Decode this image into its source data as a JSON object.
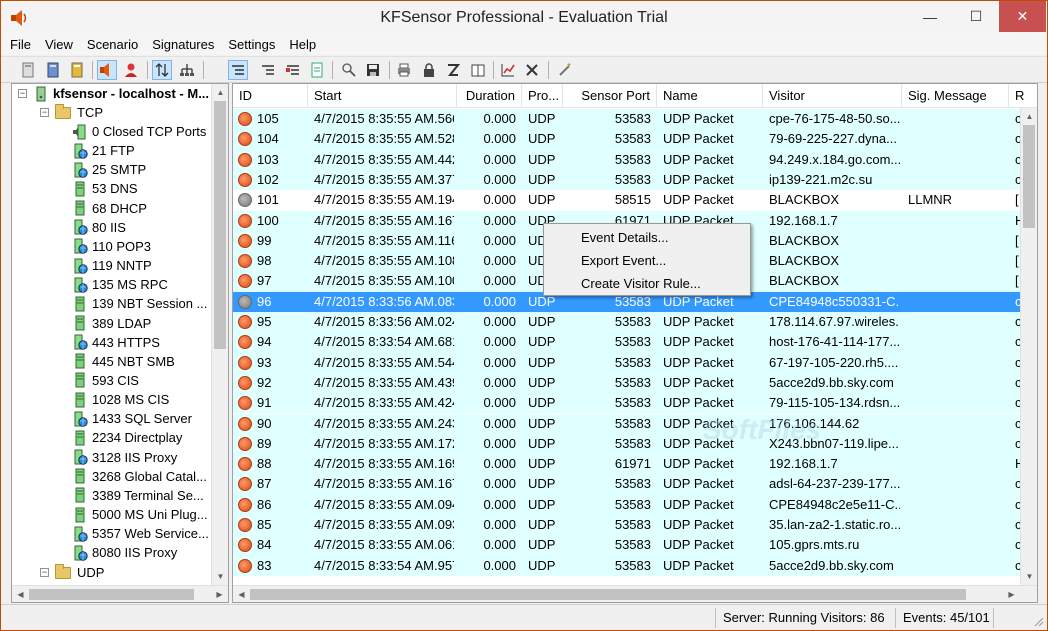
{
  "window": {
    "title": "KFSensor Professional - Evaluation Trial",
    "minimize": "—",
    "maximize": "☐",
    "close": "✕"
  },
  "menu": [
    "File",
    "View",
    "Scenario",
    "Signatures",
    "Settings",
    "Help"
  ],
  "toolbar": {
    "icons": [
      "server-icon",
      "server-blue-icon",
      "server-gold-icon",
      "speaker-icon",
      "user-icon",
      "sort-arrows-icon",
      "network-icon",
      "list-view-icon",
      "columns-icon",
      "add-column-icon",
      "export-icon",
      "magnify-icon",
      "floppy-icon",
      "printer-icon",
      "lock-icon",
      "note-icon",
      "book-icon",
      "chart-icon",
      "tools-icon",
      "wand-icon"
    ]
  },
  "tree": {
    "root": "kfsensor - localhost - M...",
    "tcp_folder": "TCP",
    "udp_folder": "UDP",
    "items": [
      {
        "label": "0  Closed TCP Ports",
        "icon": "closed-port-icon"
      },
      {
        "label": "21  FTP",
        "icon": "globe-icon"
      },
      {
        "label": "25  SMTP",
        "icon": "globe-icon"
      },
      {
        "label": "53  DNS",
        "icon": "db-icon"
      },
      {
        "label": "68  DHCP",
        "icon": "db-icon"
      },
      {
        "label": "80  IIS",
        "icon": "globe-icon"
      },
      {
        "label": "110  POP3",
        "icon": "globe-icon"
      },
      {
        "label": "119  NNTP",
        "icon": "globe-icon"
      },
      {
        "label": "135  MS RPC",
        "icon": "globe-icon"
      },
      {
        "label": "139  NBT Session ...",
        "icon": "db-icon"
      },
      {
        "label": "389  LDAP",
        "icon": "db-icon"
      },
      {
        "label": "443  HTTPS",
        "icon": "globe-icon"
      },
      {
        "label": "445  NBT SMB",
        "icon": "db-icon"
      },
      {
        "label": "593  CIS",
        "icon": "db-icon"
      },
      {
        "label": "1028  MS CIS",
        "icon": "db-icon"
      },
      {
        "label": "1433  SQL Server",
        "icon": "globe-icon"
      },
      {
        "label": "2234  Directplay",
        "icon": "db-icon"
      },
      {
        "label": "3128  IIS Proxy",
        "icon": "globe-icon"
      },
      {
        "label": "3268  Global Catal...",
        "icon": "db-icon"
      },
      {
        "label": "3389  Terminal Se...",
        "icon": "db-icon"
      },
      {
        "label": "5000  MS Uni Plug...",
        "icon": "db-icon"
      },
      {
        "label": "5357  Web Service...",
        "icon": "globe-icon"
      },
      {
        "label": "8080  IIS Proxy",
        "icon": "globe-icon"
      }
    ]
  },
  "grid": {
    "columns": [
      "ID",
      "Start",
      "Duration",
      "Pro...",
      "Sensor Port",
      "Name",
      "Visitor",
      "Sig. Message",
      "R"
    ],
    "rows": [
      {
        "id": "105",
        "start": "4/7/2015 8:35:55 AM.566",
        "duration": "0.000",
        "proto": "UDP",
        "port": "53583",
        "name": "UDP Packet",
        "visitor": "cpe-76-175-48-50.so...",
        "sig": "",
        "r": "c",
        "icon": "orange",
        "style": "cyan"
      },
      {
        "id": "104",
        "start": "4/7/2015 8:35:55 AM.528",
        "duration": "0.000",
        "proto": "UDP",
        "port": "53583",
        "name": "UDP Packet",
        "visitor": "79-69-225-227.dyna...",
        "sig": "",
        "r": "c",
        "icon": "orange",
        "style": "cyan"
      },
      {
        "id": "103",
        "start": "4/7/2015 8:35:55 AM.442",
        "duration": "0.000",
        "proto": "UDP",
        "port": "53583",
        "name": "UDP Packet",
        "visitor": "94.249.x.184.go.com....",
        "sig": "",
        "r": "c",
        "icon": "orange",
        "style": "cyan"
      },
      {
        "id": "102",
        "start": "4/7/2015 8:35:55 AM.377",
        "duration": "0.000",
        "proto": "UDP",
        "port": "53583",
        "name": "UDP Packet",
        "visitor": "ip139-221.m2c.su",
        "sig": "",
        "r": "c",
        "icon": "orange",
        "style": "cyan"
      },
      {
        "id": "101",
        "start": "4/7/2015 8:35:55 AM.194",
        "duration": "0.000",
        "proto": "UDP",
        "port": "58515",
        "name": "UDP Packet",
        "visitor": "BLACKBOX",
        "sig": "LLMNR",
        "r": "[",
        "icon": "grey",
        "style": "white"
      },
      {
        "id": "100",
        "start": "4/7/2015 8:35:55 AM.167",
        "duration": "0.000",
        "proto": "UDP",
        "port": "61971",
        "name": "UDP Packet",
        "visitor": "192.168.1.7",
        "sig": "",
        "r": "H",
        "icon": "orange",
        "style": "cyan"
      },
      {
        "id": "99",
        "start": "4/7/2015 8:35:55 AM.116",
        "duration": "0.000",
        "proto": "UDP",
        "port": "",
        "name": "",
        "visitor": "BLACKBOX",
        "sig": "",
        "r": "[",
        "icon": "orange",
        "style": "cyan"
      },
      {
        "id": "98",
        "start": "4/7/2015 8:35:55 AM.108",
        "duration": "0.000",
        "proto": "UDP",
        "port": "",
        "name": "",
        "visitor": "BLACKBOX",
        "sig": "",
        "r": "[",
        "icon": "orange",
        "style": "cyan"
      },
      {
        "id": "97",
        "start": "4/7/2015 8:35:55 AM.100",
        "duration": "0.000",
        "proto": "UDP",
        "port": "",
        "name": "",
        "visitor": "BLACKBOX",
        "sig": "",
        "r": "[",
        "icon": "orange",
        "style": "cyan"
      },
      {
        "id": "96",
        "start": "4/7/2015 8:33:56 AM.083",
        "duration": "0.000",
        "proto": "UDP",
        "port": "53583",
        "name": "UDP Packet",
        "visitor": "CPE84948c550331-C...",
        "sig": "",
        "r": "c",
        "icon": "grey",
        "style": "selected"
      },
      {
        "id": "95",
        "start": "4/7/2015 8:33:56 AM.024",
        "duration": "0.000",
        "proto": "UDP",
        "port": "53583",
        "name": "UDP Packet",
        "visitor": "178.114.67.97.wireles...",
        "sig": "",
        "r": "c",
        "icon": "orange",
        "style": "cyan"
      },
      {
        "id": "94",
        "start": "4/7/2015 8:33:54 AM.681",
        "duration": "0.000",
        "proto": "UDP",
        "port": "53583",
        "name": "UDP Packet",
        "visitor": "host-176-41-114-177...",
        "sig": "",
        "r": "c",
        "icon": "orange",
        "style": "cyan"
      },
      {
        "id": "93",
        "start": "4/7/2015 8:33:55 AM.544",
        "duration": "0.000",
        "proto": "UDP",
        "port": "53583",
        "name": "UDP Packet",
        "visitor": "67-197-105-220.rh5....",
        "sig": "",
        "r": "c",
        "icon": "orange",
        "style": "cyan"
      },
      {
        "id": "92",
        "start": "4/7/2015 8:33:55 AM.439",
        "duration": "0.000",
        "proto": "UDP",
        "port": "53583",
        "name": "UDP Packet",
        "visitor": "5acce2d9.bb.sky.com",
        "sig": "",
        "r": "c",
        "icon": "orange",
        "style": "cyan"
      },
      {
        "id": "91",
        "start": "4/7/2015 8:33:55 AM.424",
        "duration": "0.000",
        "proto": "UDP",
        "port": "53583",
        "name": "UDP Packet",
        "visitor": "79-115-105-134.rdsn...",
        "sig": "",
        "r": "c",
        "icon": "orange",
        "style": "cyan"
      },
      {
        "id": "90",
        "start": "4/7/2015 8:33:55 AM.243",
        "duration": "0.000",
        "proto": "UDP",
        "port": "53583",
        "name": "UDP Packet",
        "visitor": "176.106.144.62",
        "sig": "",
        "r": "c",
        "icon": "orange",
        "style": "cyan"
      },
      {
        "id": "89",
        "start": "4/7/2015 8:33:55 AM.172",
        "duration": "0.000",
        "proto": "UDP",
        "port": "53583",
        "name": "UDP Packet",
        "visitor": "X243.bbn07-119.lipe....",
        "sig": "",
        "r": "c",
        "icon": "orange",
        "style": "cyan"
      },
      {
        "id": "88",
        "start": "4/7/2015 8:33:55 AM.169",
        "duration": "0.000",
        "proto": "UDP",
        "port": "61971",
        "name": "UDP Packet",
        "visitor": "192.168.1.7",
        "sig": "",
        "r": "H",
        "icon": "orange",
        "style": "cyan"
      },
      {
        "id": "87",
        "start": "4/7/2015 8:33:55 AM.167",
        "duration": "0.000",
        "proto": "UDP",
        "port": "53583",
        "name": "UDP Packet",
        "visitor": "adsl-64-237-239-177...",
        "sig": "",
        "r": "c",
        "icon": "orange",
        "style": "cyan"
      },
      {
        "id": "86",
        "start": "4/7/2015 8:33:55 AM.094",
        "duration": "0.000",
        "proto": "UDP",
        "port": "53583",
        "name": "UDP Packet",
        "visitor": "CPE84948c2e5e11-C...",
        "sig": "",
        "r": "c",
        "icon": "orange",
        "style": "cyan"
      },
      {
        "id": "85",
        "start": "4/7/2015 8:33:55 AM.093",
        "duration": "0.000",
        "proto": "UDP",
        "port": "53583",
        "name": "UDP Packet",
        "visitor": "35.lan-za2-1.static.ro...",
        "sig": "",
        "r": "c",
        "icon": "orange",
        "style": "cyan"
      },
      {
        "id": "84",
        "start": "4/7/2015 8:33:55 AM.061",
        "duration": "0.000",
        "proto": "UDP",
        "port": "53583",
        "name": "UDP Packet",
        "visitor": "105.gprs.mts.ru",
        "sig": "",
        "r": "c",
        "icon": "orange",
        "style": "cyan"
      },
      {
        "id": "83",
        "start": "4/7/2015 8:33:54 AM.957",
        "duration": "0.000",
        "proto": "UDP",
        "port": "53583",
        "name": "UDP Packet",
        "visitor": "5acce2d9.bb.sky.com",
        "sig": "",
        "r": "c",
        "icon": "orange",
        "style": "cyan"
      }
    ]
  },
  "context_menu": [
    "Event Details...",
    "Export Event...",
    "Create Visitor Rule..."
  ],
  "status": {
    "server": "Server: Running Visitors: 86",
    "events": "Events: 45/101"
  },
  "colors": {
    "row_highlight": "#e0ffff",
    "selected": "#3399ff",
    "close_button": "#c75050"
  }
}
